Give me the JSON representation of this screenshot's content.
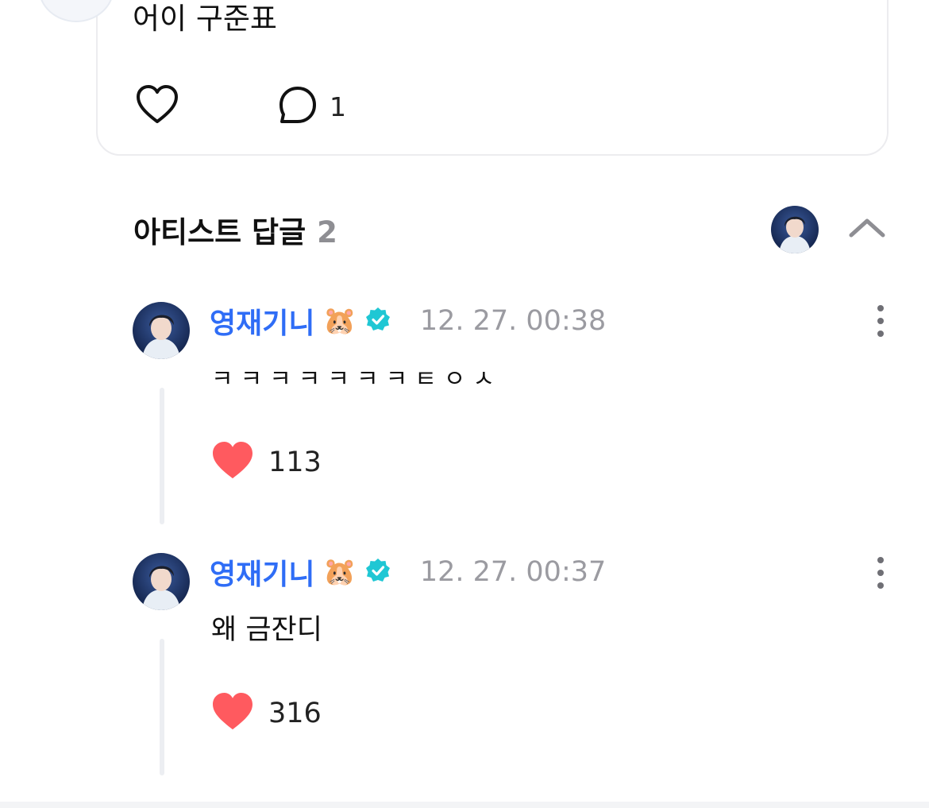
{
  "post": {
    "text": "어이 구준표",
    "comment_count": "1"
  },
  "artist_replies": {
    "title": "아티스트 답글",
    "count": "2"
  },
  "replies": [
    {
      "name": "영재기니",
      "emoji": "🐹",
      "time": "12. 27. 00:38",
      "text": "ㅋㅋㅋㅋㅋㅋㅋㅌㅇㅅ",
      "likes": "113"
    },
    {
      "name": "영재기니",
      "emoji": "🐹",
      "time": "12. 27. 00:37",
      "text": "왜 금잔디",
      "likes": "316"
    }
  ],
  "colors": {
    "accent_name": "#2f6df6",
    "verified": "#1fc7d4",
    "heart": "#ff5a5f"
  }
}
